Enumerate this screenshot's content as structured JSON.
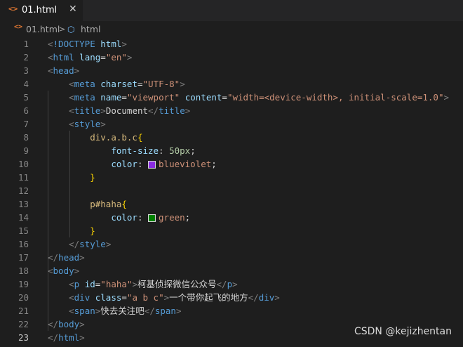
{
  "tab": {
    "html_icon": "<>",
    "label": "01.html",
    "close": "✕"
  },
  "breadcrumb": {
    "file_icon": "<>",
    "file": "01.html",
    "separator": ">",
    "symbol_icon": "⬡",
    "symbol": "html"
  },
  "colors": {
    "blueviolet": "#8a2be2",
    "green": "#008000"
  },
  "lines": [
    {
      "n": "1",
      "tokens": [
        {
          "c": "t-punct",
          "t": "<"
        },
        {
          "c": "t-tag",
          "t": "!DOCTYPE"
        },
        {
          "c": "t-text",
          "t": " "
        },
        {
          "c": "t-attr",
          "t": "html"
        },
        {
          "c": "t-punct",
          "t": ">"
        }
      ]
    },
    {
      "n": "2",
      "tokens": [
        {
          "c": "t-punct",
          "t": "<"
        },
        {
          "c": "t-tag",
          "t": "html"
        },
        {
          "c": "t-text",
          "t": " "
        },
        {
          "c": "t-attr",
          "t": "lang"
        },
        {
          "c": "t-text",
          "t": "="
        },
        {
          "c": "t-str",
          "t": "\"en\""
        },
        {
          "c": "t-punct",
          "t": ">"
        }
      ]
    },
    {
      "n": "3",
      "tokens": [
        {
          "c": "t-punct",
          "t": "<"
        },
        {
          "c": "t-tag",
          "t": "head"
        },
        {
          "c": "t-punct",
          "t": ">"
        }
      ]
    },
    {
      "n": "4",
      "tokens": [
        {
          "c": "t-text",
          "t": "    "
        },
        {
          "c": "t-punct",
          "t": "<"
        },
        {
          "c": "t-tag",
          "t": "meta"
        },
        {
          "c": "t-text",
          "t": " "
        },
        {
          "c": "t-attr",
          "t": "charset"
        },
        {
          "c": "t-text",
          "t": "="
        },
        {
          "c": "t-str",
          "t": "\"UTF-8\""
        },
        {
          "c": "t-punct",
          "t": ">"
        }
      ]
    },
    {
      "n": "5",
      "tokens": [
        {
          "c": "t-text",
          "t": "    "
        },
        {
          "c": "t-punct",
          "t": "<"
        },
        {
          "c": "t-tag",
          "t": "meta"
        },
        {
          "c": "t-text",
          "t": " "
        },
        {
          "c": "t-attr",
          "t": "name"
        },
        {
          "c": "t-text",
          "t": "="
        },
        {
          "c": "t-str",
          "t": "\"viewport\""
        },
        {
          "c": "t-text",
          "t": " "
        },
        {
          "c": "t-attr",
          "t": "content"
        },
        {
          "c": "t-text",
          "t": "="
        },
        {
          "c": "t-str",
          "t": "\"width=<device-width>, initial-scale=1.0\""
        },
        {
          "c": "t-punct",
          "t": ">"
        }
      ]
    },
    {
      "n": "6",
      "tokens": [
        {
          "c": "t-text",
          "t": "    "
        },
        {
          "c": "t-punct",
          "t": "<"
        },
        {
          "c": "t-tag",
          "t": "title"
        },
        {
          "c": "t-punct",
          "t": ">"
        },
        {
          "c": "t-text",
          "t": "Document"
        },
        {
          "c": "t-punct",
          "t": "</"
        },
        {
          "c": "t-tag",
          "t": "title"
        },
        {
          "c": "t-punct",
          "t": ">"
        }
      ]
    },
    {
      "n": "7",
      "tokens": [
        {
          "c": "t-text",
          "t": "    "
        },
        {
          "c": "t-punct",
          "t": "<"
        },
        {
          "c": "t-tag",
          "t": "style"
        },
        {
          "c": "t-punct",
          "t": ">"
        }
      ]
    },
    {
      "n": "8",
      "tokens": [
        {
          "c": "t-text",
          "t": "        "
        },
        {
          "c": "t-sel",
          "t": "div.a.b.c"
        },
        {
          "c": "t-brace",
          "t": "{"
        }
      ]
    },
    {
      "n": "9",
      "tokens": [
        {
          "c": "t-text",
          "t": "            "
        },
        {
          "c": "t-attr",
          "t": "font-size"
        },
        {
          "c": "t-text",
          "t": ": "
        },
        {
          "c": "t-num",
          "t": "50px"
        },
        {
          "c": "t-text",
          "t": ";"
        }
      ]
    },
    {
      "n": "10",
      "tokens": [
        {
          "c": "t-text",
          "t": "            "
        },
        {
          "c": "t-attr",
          "t": "color"
        },
        {
          "c": "t-text",
          "t": ": "
        },
        {
          "c": "swatch",
          "t": "blueviolet"
        },
        {
          "c": "t-str",
          "t": "blueviolet"
        },
        {
          "c": "t-text",
          "t": ";"
        }
      ]
    },
    {
      "n": "11",
      "tokens": [
        {
          "c": "t-text",
          "t": "        "
        },
        {
          "c": "t-brace",
          "t": "}"
        }
      ]
    },
    {
      "n": "12",
      "tokens": []
    },
    {
      "n": "13",
      "tokens": [
        {
          "c": "t-text",
          "t": "        "
        },
        {
          "c": "t-sel",
          "t": "p#haha"
        },
        {
          "c": "t-brace",
          "t": "{"
        }
      ]
    },
    {
      "n": "14",
      "tokens": [
        {
          "c": "t-text",
          "t": "            "
        },
        {
          "c": "t-attr",
          "t": "color"
        },
        {
          "c": "t-text",
          "t": ": "
        },
        {
          "c": "swatch",
          "t": "green"
        },
        {
          "c": "t-str",
          "t": "green"
        },
        {
          "c": "t-text",
          "t": ";"
        }
      ]
    },
    {
      "n": "15",
      "tokens": [
        {
          "c": "t-text",
          "t": "        "
        },
        {
          "c": "t-brace",
          "t": "}"
        }
      ]
    },
    {
      "n": "16",
      "tokens": [
        {
          "c": "t-text",
          "t": "    "
        },
        {
          "c": "t-punct",
          "t": "</"
        },
        {
          "c": "t-tag",
          "t": "style"
        },
        {
          "c": "t-punct",
          "t": ">"
        }
      ]
    },
    {
      "n": "17",
      "tokens": [
        {
          "c": "t-punct",
          "t": "</"
        },
        {
          "c": "t-tag",
          "t": "head"
        },
        {
          "c": "t-punct",
          "t": ">"
        }
      ]
    },
    {
      "n": "18",
      "tokens": [
        {
          "c": "t-punct",
          "t": "<"
        },
        {
          "c": "t-tag",
          "t": "body"
        },
        {
          "c": "t-punct",
          "t": ">"
        }
      ]
    },
    {
      "n": "19",
      "tokens": [
        {
          "c": "t-text",
          "t": "    "
        },
        {
          "c": "t-punct",
          "t": "<"
        },
        {
          "c": "t-tag",
          "t": "p"
        },
        {
          "c": "t-text",
          "t": " "
        },
        {
          "c": "t-attr",
          "t": "id"
        },
        {
          "c": "t-text",
          "t": "="
        },
        {
          "c": "t-str",
          "t": "\"haha\""
        },
        {
          "c": "t-punct",
          "t": ">"
        },
        {
          "c": "t-text",
          "t": "柯基侦探微信公众号"
        },
        {
          "c": "t-punct",
          "t": "</"
        },
        {
          "c": "t-tag",
          "t": "p"
        },
        {
          "c": "t-punct",
          "t": ">"
        }
      ]
    },
    {
      "n": "20",
      "tokens": [
        {
          "c": "t-text",
          "t": "    "
        },
        {
          "c": "t-punct",
          "t": "<"
        },
        {
          "c": "t-tag",
          "t": "div"
        },
        {
          "c": "t-text",
          "t": " "
        },
        {
          "c": "t-attr",
          "t": "class"
        },
        {
          "c": "t-text",
          "t": "="
        },
        {
          "c": "t-str",
          "t": "\"a b c\""
        },
        {
          "c": "t-punct",
          "t": ">"
        },
        {
          "c": "t-text",
          "t": "一个带你起飞的地方"
        },
        {
          "c": "t-punct",
          "t": "</"
        },
        {
          "c": "t-tag",
          "t": "div"
        },
        {
          "c": "t-punct",
          "t": ">"
        }
      ]
    },
    {
      "n": "21",
      "tokens": [
        {
          "c": "t-text",
          "t": "    "
        },
        {
          "c": "t-punct",
          "t": "<"
        },
        {
          "c": "t-tag",
          "t": "span"
        },
        {
          "c": "t-punct",
          "t": ">"
        },
        {
          "c": "t-text",
          "t": "快去关注吧"
        },
        {
          "c": "t-punct",
          "t": "</"
        },
        {
          "c": "t-tag",
          "t": "span"
        },
        {
          "c": "t-punct",
          "t": ">"
        }
      ]
    },
    {
      "n": "22",
      "tokens": [
        {
          "c": "t-punct",
          "t": "</"
        },
        {
          "c": "t-tag",
          "t": "body"
        },
        {
          "c": "t-punct",
          "t": ">"
        }
      ]
    },
    {
      "n": "23",
      "active": true,
      "tokens": [
        {
          "c": "t-punct",
          "t": "</"
        },
        {
          "c": "t-tag",
          "t": "html"
        },
        {
          "c": "t-punct",
          "t": ">"
        }
      ]
    }
  ],
  "watermark": "CSDN @kejizhentan"
}
